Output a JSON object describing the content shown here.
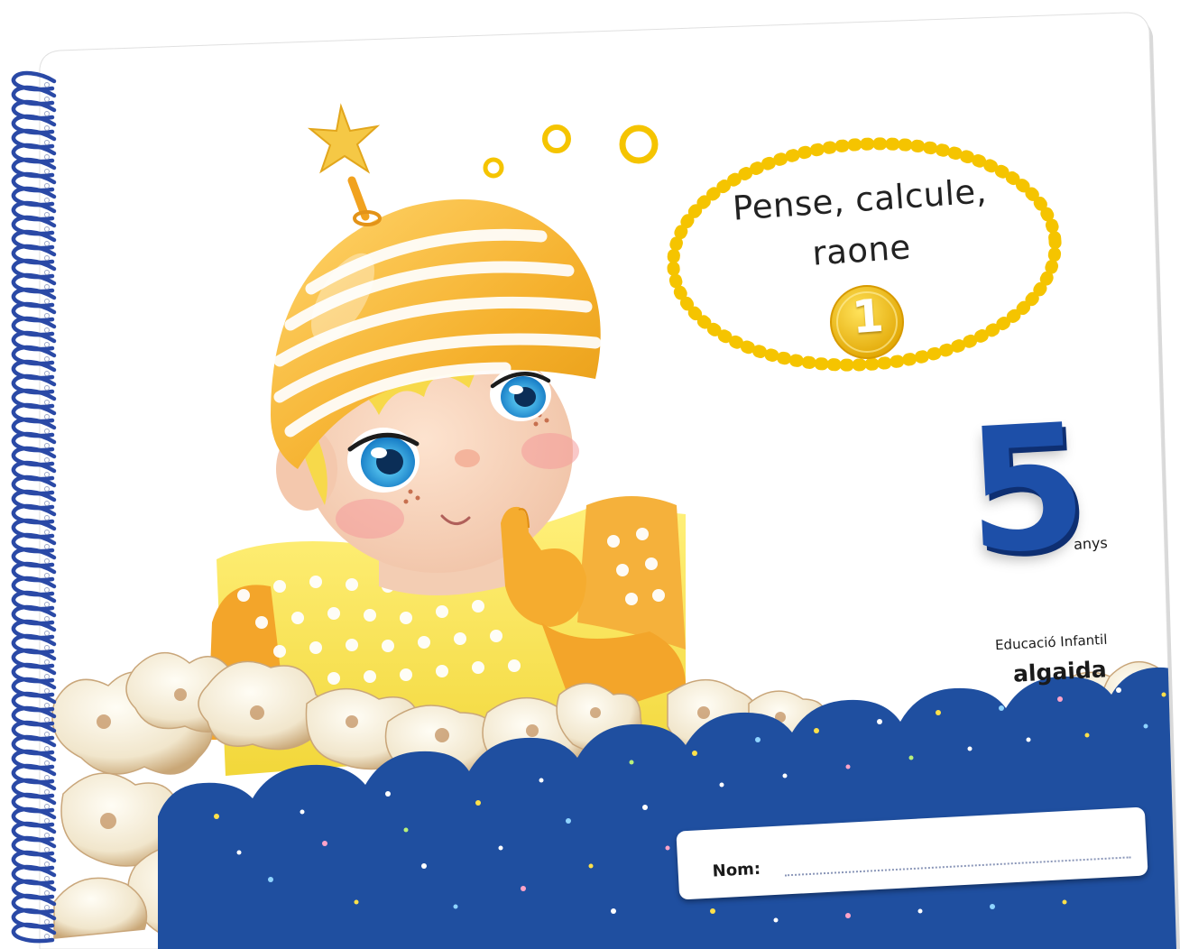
{
  "cover": {
    "title_line1": "Pense, calcule,",
    "title_line2": "raone",
    "volume": "1",
    "age_number": "5",
    "age_unit": "anys",
    "series": "Educació Infantil",
    "publisher": "algaida",
    "name_label": "Nom:"
  },
  "colors": {
    "brand_blue": "#1d4fa8",
    "wave_blue": "#1f4fa0",
    "sun_yellow": "#f5c400",
    "hat_orange": "#f3b12e",
    "spiral_blue": "#2a49a6"
  },
  "icons": {
    "spiral": "spiral-binding-icon",
    "character": "elf-character-illustration",
    "popcorn": "popcorn-illustration",
    "thought_bubble": "thought-bubble-icon"
  }
}
